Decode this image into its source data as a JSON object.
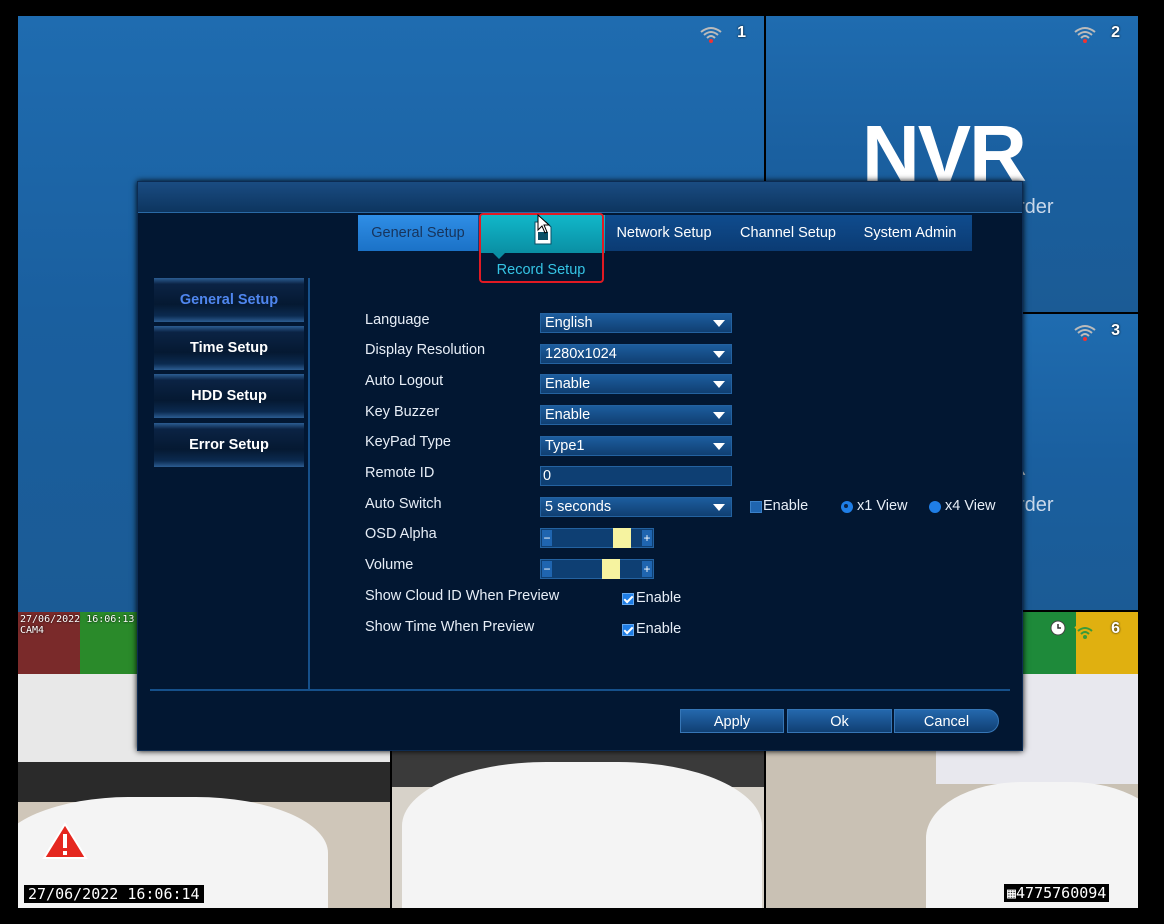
{
  "channels": {
    "ch1": "1",
    "ch2": "2",
    "ch3": "3",
    "ch6": "6"
  },
  "background": {
    "logo_text": "NVR",
    "logo_sub_top": "rder",
    "logo_sub_bottom": "rder",
    "cam_osd_date": "27/06/2022 16:06:13",
    "cam_osd_name": "CAM4",
    "osd_datetime": "27/06/2022 16:06:14",
    "serial": "4775760094"
  },
  "topnav": {
    "general": "General Setup",
    "record": "Record Setup",
    "network": "Network Setup",
    "channel": "Channel Setup",
    "admin": "System Admin"
  },
  "sidebar": {
    "items": [
      {
        "label": "General Setup"
      },
      {
        "label": "Time Setup"
      },
      {
        "label": "HDD Setup"
      },
      {
        "label": "Error Setup"
      }
    ]
  },
  "form": {
    "language": {
      "label": "Language",
      "value": "English"
    },
    "resolution": {
      "label": "Display Resolution",
      "value": "1280x1024"
    },
    "auto_logout": {
      "label": "Auto Logout",
      "value": "Enable"
    },
    "key_buzzer": {
      "label": "Key Buzzer",
      "value": "Enable"
    },
    "keypad_type": {
      "label": "KeyPad Type",
      "value": "Type1"
    },
    "remote_id": {
      "label": "Remote ID",
      "value": "0"
    },
    "auto_switch": {
      "label": "Auto Switch",
      "value": "5 seconds",
      "enable_label": "Enable",
      "enabled": false,
      "x1_label": "x1 View",
      "x4_label": "x4 View",
      "view_selected": "x1"
    },
    "osd_alpha": {
      "label": "OSD Alpha",
      "level": 0.85
    },
    "volume": {
      "label": "Volume",
      "level": 0.7
    },
    "show_cloud_id": {
      "label": "Show Cloud ID When Preview",
      "enable_label": "Enable",
      "checked": true
    },
    "show_time": {
      "label": "Show Time When Preview",
      "enable_label": "Enable",
      "checked": true
    }
  },
  "buttons": {
    "apply": "Apply",
    "ok": "Ok",
    "cancel": "Cancel"
  },
  "colors": {
    "accent": "#0a8fa4",
    "highlight": "#e11a23",
    "dialog_bg": "#021732"
  }
}
